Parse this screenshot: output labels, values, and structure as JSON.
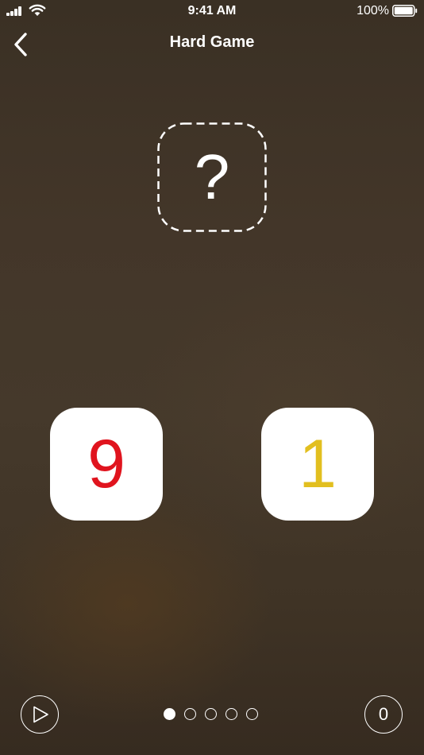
{
  "status_bar": {
    "time": "9:41 AM",
    "battery_percent": "100%",
    "icons": [
      "signal-icon",
      "wifi-icon",
      "battery-icon"
    ]
  },
  "nav": {
    "title": "Hard Game",
    "back_icon": "chevron-left-icon"
  },
  "answer_slot": {
    "symbol": "?"
  },
  "tiles": [
    {
      "value": "9",
      "color": "#e0141e"
    },
    {
      "value": "1",
      "color": "#e2bf1f"
    }
  ],
  "footer": {
    "play_icon": "play-icon",
    "pages": {
      "total": 5,
      "current": 1
    },
    "score": "0"
  },
  "colors": {
    "background": "#433629",
    "tile_background": "#ffffff",
    "foreground": "#ffffff"
  }
}
